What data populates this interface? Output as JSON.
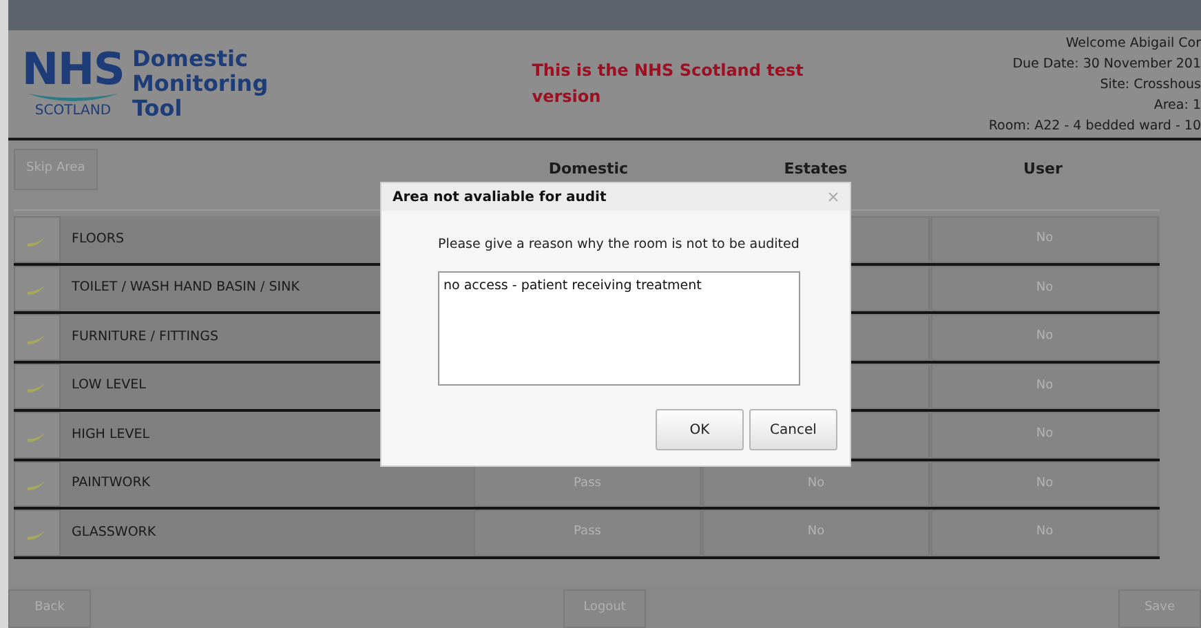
{
  "header": {
    "logo": {
      "mark": "NHS",
      "sub": "SCOTLAND"
    },
    "app_title": [
      "Domestic",
      "Monitoring",
      "Tool"
    ],
    "notice": "This is the NHS Scotland test version",
    "info": [
      "Welcome Abigail Cor",
      "Due Date: 30 November 201",
      "Site: Crosshous",
      "Area: 1",
      "Room: A22 - 4 bedded ward - 10"
    ]
  },
  "toolbar": {
    "skip_button": "Skip Area",
    "columns": [
      "Domestic",
      "Estates",
      "User"
    ]
  },
  "rows": [
    {
      "label": "FLOORS",
      "user": "No"
    },
    {
      "label": "TOILET / WASH HAND BASIN / SINK",
      "user": "No"
    },
    {
      "label": "FURNITURE / FITTINGS",
      "user": "No"
    },
    {
      "label": "LOW LEVEL",
      "user": "No"
    },
    {
      "label": "HIGH LEVEL",
      "user": "No"
    },
    {
      "label": "PAINTWORK",
      "domestic": "Pass",
      "estates": "No",
      "user": "No"
    },
    {
      "label": "GLASSWORK",
      "domestic": "Pass",
      "estates": "No",
      "user": "No"
    }
  ],
  "footer": {
    "buttons": [
      "Back",
      "Logout",
      "Save"
    ]
  },
  "dialog": {
    "title": "Area not avaliable for audit",
    "prompt": "Please give a reason why the room is not to be audited",
    "reason": "no access - patient receiving treatment",
    "buttons": [
      "OK",
      "Cancel"
    ]
  }
}
